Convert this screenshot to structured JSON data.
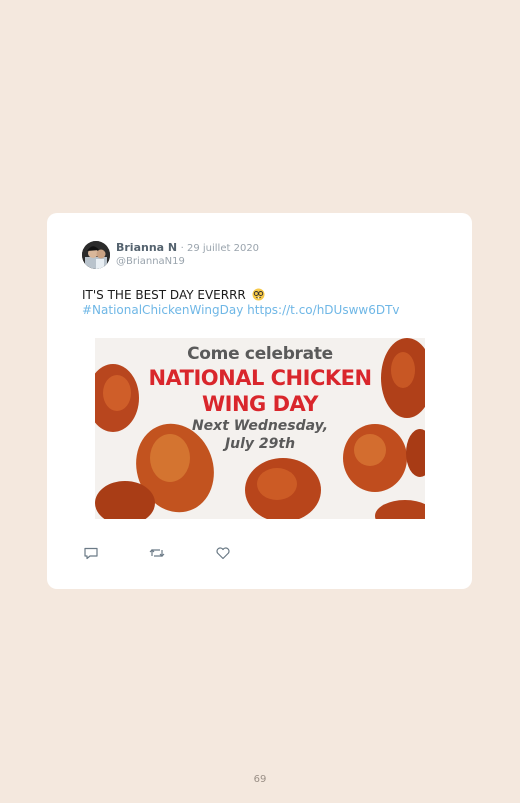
{
  "tweet": {
    "author_name": "Brianna N",
    "date": "· 29 juillet 2020",
    "handle": "@BriannaN19",
    "text": "IT'S THE BEST DAY EVERRR",
    "emoji": "nerd-face-emoji",
    "hashtag": "#NationalChickenWingDay",
    "link": "https://t.co/hDUsww6DTv",
    "media": {
      "line1": "Come celebrate",
      "line2": "NATIONAL CHICKEN",
      "line3": "WING DAY",
      "line4": "Next Wednesday,",
      "line5": "July 29th"
    },
    "actions": {
      "reply_icon": "reply-icon",
      "retweet_icon": "retweet-icon",
      "like_icon": "heart-icon"
    }
  },
  "page": {
    "number": "69"
  },
  "colors": {
    "background": "#f4e8de",
    "card": "#ffffff",
    "link": "#6fb7e6",
    "headline_red": "#d9262c",
    "headline_gray": "#5a5a5a"
  }
}
